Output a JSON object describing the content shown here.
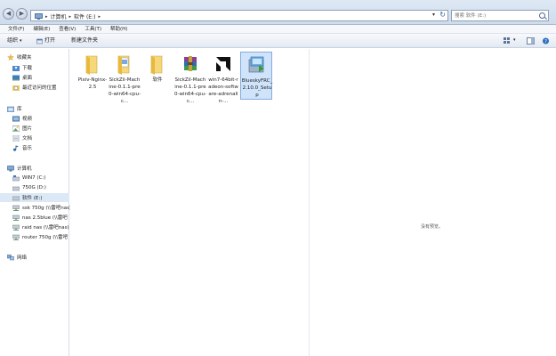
{
  "address": {
    "crumbs": [
      "计算机",
      "软件 (E:)"
    ],
    "search_placeholder": "搜索 软件 (E:)"
  },
  "menu": [
    "文件(F)",
    "编辑(E)",
    "查看(V)",
    "工具(T)",
    "帮助(H)"
  ],
  "toolbar": {
    "organize": "组织",
    "open": "打开",
    "new_folder": "新建文件夹"
  },
  "nav": {
    "favorites": {
      "label": "收藏夹",
      "items": [
        "下载",
        "桌面",
        "最近访问的位置"
      ]
    },
    "libraries": {
      "label": "库",
      "items": [
        "视频",
        "图片",
        "文档",
        "音乐"
      ]
    },
    "computer": {
      "label": "计算机",
      "items": [
        "WIN7 (C:)",
        "750G (D:)",
        "软件 (E:)",
        "ssk 750g (\\\\雷吧nas)",
        "nas 2.5blue (\\\\雷吧",
        "raid nas (\\\\雷吧nas)",
        "router 750g (\\\\雷吧"
      ]
    },
    "network": {
      "label": "网络"
    }
  },
  "files": [
    {
      "name": "Pixiv-Nginx-2.5",
      "type": "folder"
    },
    {
      "name": "SickZil-Machine-0.1.1-pre0-win64-cpu-c...",
      "type": "folder-docs"
    },
    {
      "name": "软件",
      "type": "folder"
    },
    {
      "name": "SickZil-Machine-0.1.1-pre0-win64-cpu-c...",
      "type": "rar"
    },
    {
      "name": "win7-64bit-radeon-software-adrenalin-...",
      "type": "amd"
    },
    {
      "name": "BlueskyFRC_2.10.0_Setup",
      "type": "setup"
    }
  ],
  "preview": {
    "message": "没有预览。"
  },
  "colors": {
    "selection": "#cfe3fa",
    "nav_selected": "#dce8f6",
    "folder": "#f0c95a"
  }
}
